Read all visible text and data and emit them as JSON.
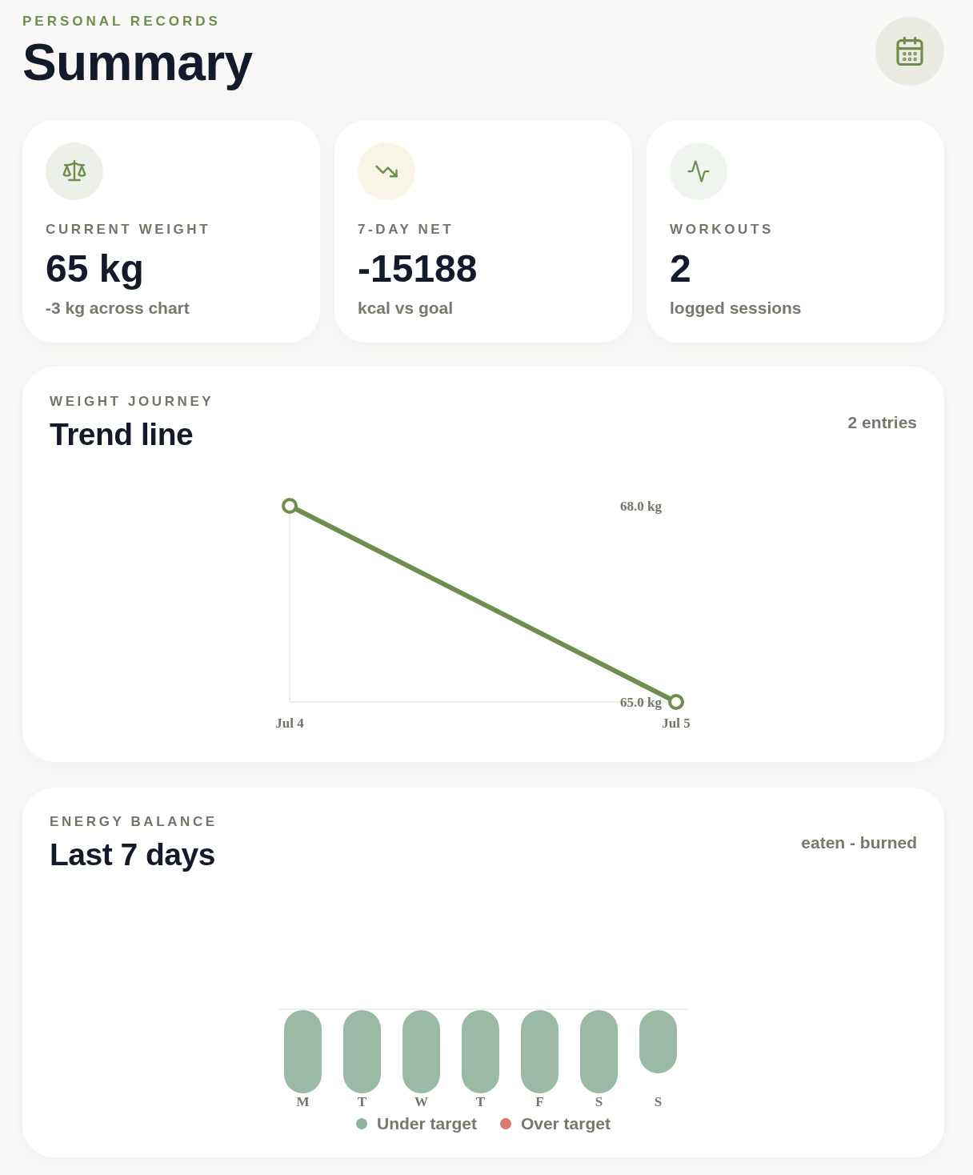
{
  "header": {
    "eyebrow": "PERSONAL RECORDS",
    "title": "Summary"
  },
  "stats": [
    {
      "kind": "weight",
      "label": "CURRENT WEIGHT",
      "value": "65 kg",
      "note": "-3 kg across chart"
    },
    {
      "kind": "energy",
      "label": "7-DAY NET",
      "value": "-15188",
      "note": "kcal vs goal"
    },
    {
      "kind": "workouts",
      "label": "WORKOUTS",
      "value": "2",
      "note": "logged sessions"
    }
  ],
  "weight_journey": {
    "eyebrow": "WEIGHT JOURNEY",
    "title": "Trend line",
    "count": "2 entries",
    "chart_data": {
      "type": "line",
      "categories": [
        "Jul 4",
        "Jul 5"
      ],
      "series": [
        {
          "color": "#6f8d4e",
          "marker": "circle",
          "values": [
            68,
            65
          ]
        }
      ],
      "ylim": [
        65,
        68
      ],
      "yticks": [
        {
          "value": 68,
          "label": "68.0 kg"
        },
        {
          "value": 65,
          "label": "65.0 kg"
        }
      ]
    }
  },
  "energy_balance": {
    "eyebrow": "ENERGY BALANCE",
    "title": "Last 7 days",
    "caption": "eaten - burned",
    "days": [
      {
        "label": "M",
        "over_target": false
      },
      {
        "label": "T",
        "over_target": false
      },
      {
        "label": "W",
        "over_target": false
      },
      {
        "label": "T",
        "over_target": false
      },
      {
        "label": "F",
        "over_target": false
      },
      {
        "label": "S",
        "over_target": false
      },
      {
        "label": "S",
        "over_target": false
      }
    ],
    "legend": [
      {
        "label": "Under target",
        "color": "#8fb39c"
      },
      {
        "label": "Over target",
        "color": "#d97b6b"
      }
    ]
  }
}
